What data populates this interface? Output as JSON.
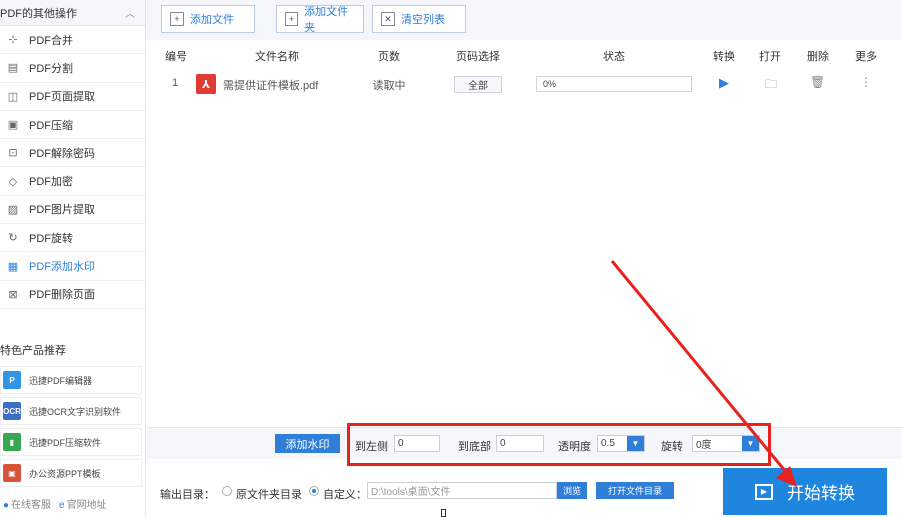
{
  "sidebar": {
    "header": "PDF的其他操作",
    "items": [
      {
        "label": "PDF合并",
        "icon": "merge-icon",
        "glyph": "⊹"
      },
      {
        "label": "PDF分割",
        "icon": "split-icon",
        "glyph": "▤"
      },
      {
        "label": "PDF页面提取",
        "icon": "extract-page-icon",
        "glyph": "◫"
      },
      {
        "label": "PDF压缩",
        "icon": "compress-icon",
        "glyph": "▣"
      },
      {
        "label": "PDF解除密码",
        "icon": "unlock-icon",
        "glyph": "⊡"
      },
      {
        "label": "PDF加密",
        "icon": "shield-icon",
        "glyph": "◇"
      },
      {
        "label": "PDF图片提取",
        "icon": "image-icon",
        "glyph": "▨"
      },
      {
        "label": "PDF旋转",
        "icon": "rotate-icon",
        "glyph": "↻"
      },
      {
        "label": "PDF添加水印",
        "icon": "watermark-icon",
        "glyph": "▦",
        "active": true
      },
      {
        "label": "PDF删除页面",
        "icon": "delete-page-icon",
        "glyph": "⊠"
      }
    ],
    "recommend_title": "特色产品推荐",
    "recommend": [
      {
        "label": "迅捷PDF编辑器",
        "icon": "pdf-editor-logo",
        "logo": "P",
        "color": "#2f95e6"
      },
      {
        "label": "迅捷OCR文字识别软件",
        "icon": "ocr-logo",
        "logo": "OCR",
        "color": "#3a6fc4"
      },
      {
        "label": "迅捷PDF压缩软件",
        "icon": "pdf-compress-logo",
        "logo": "▮",
        "color": "#37a852"
      },
      {
        "label": "办公资源PPT模板",
        "icon": "ppt-template-logo",
        "logo": "▣",
        "color": "#d9533b"
      }
    ],
    "footer": {
      "service": "在线客服",
      "website": "官网地址"
    }
  },
  "toolbar": {
    "add_file": "添加文件",
    "add_folder": "添加文件夹",
    "clear_list": "清空列表"
  },
  "table": {
    "headers": [
      "编号",
      "文件名称",
      "页数",
      "页码选择",
      "状态",
      "转换",
      "打开",
      "删除",
      "更多"
    ],
    "rows": [
      {
        "index": "1",
        "filename": "需提供证件模板.pdf",
        "pages": "读取中",
        "page_select": "全部",
        "status": "0%"
      }
    ]
  },
  "watermark": {
    "add_button": "添加水印",
    "left_label": "到左侧",
    "left_value": "0",
    "bottom_label": "到底部",
    "bottom_value": "0",
    "opacity_label": "透明度",
    "opacity_value": "0.5",
    "rotate_label": "旋转",
    "rotate_value": "0度"
  },
  "output": {
    "label": "输出目录：",
    "opt_original": "原文件夹目录",
    "opt_custom": "自定义：",
    "path": "D:\\tools\\桌面\\文件",
    "browse": "浏览",
    "open_dir": "打开文件目录"
  },
  "start_button": "开始转换",
  "colors": {
    "accent": "#2f7fd9",
    "start": "#1f86e0",
    "annotation": "#e8221f"
  }
}
